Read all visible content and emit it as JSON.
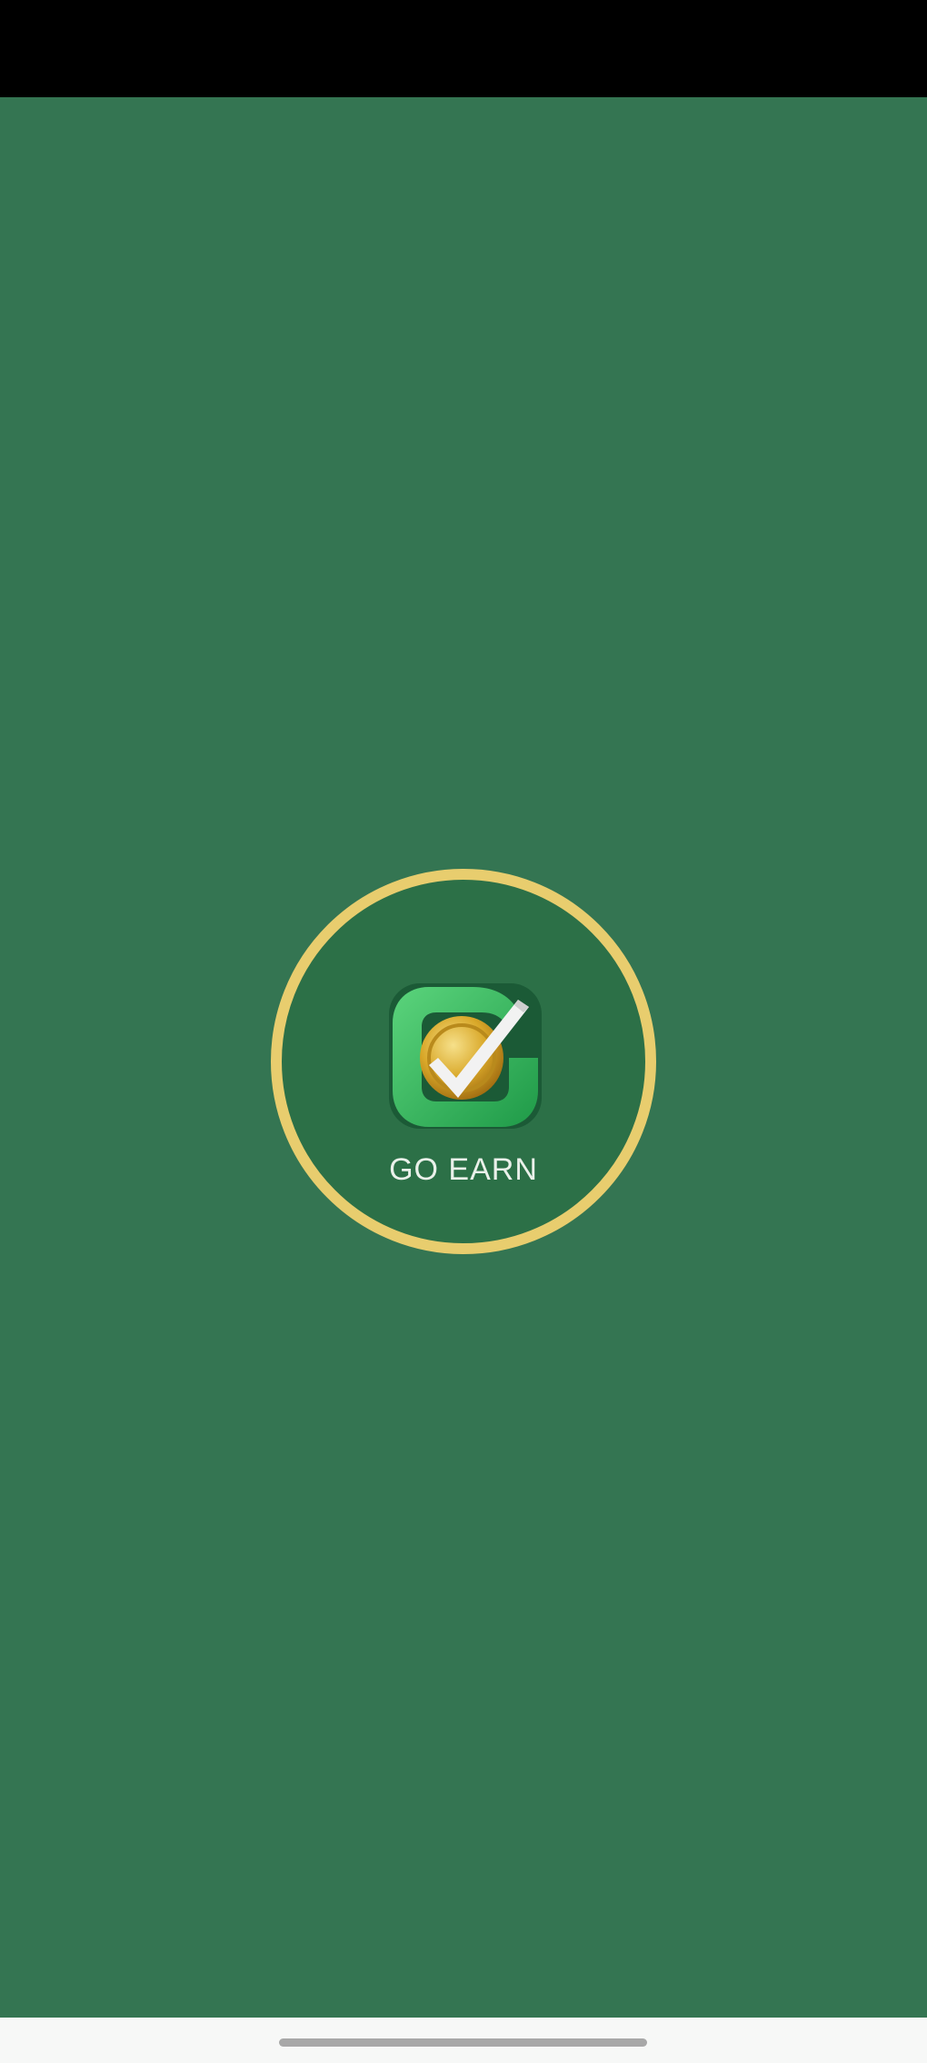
{
  "app": {
    "name": "GO EARN",
    "logo_icon": "go-earn-coin-check-icon"
  },
  "colors": {
    "status_bar": "#000000",
    "background": "#347552",
    "ring": "#e8cd6e",
    "ring_fill": "#2c7047",
    "app_name_text": "#eaf1ea",
    "nav_bar": "#f7f8f7",
    "home_indicator": "#a8a8a8"
  }
}
